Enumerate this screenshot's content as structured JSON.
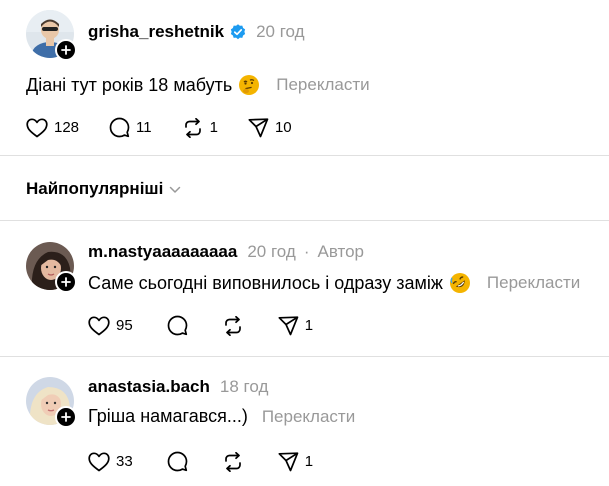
{
  "post": {
    "username": "grisha_reshetnik",
    "verified_icon": "verified-badge-icon",
    "time": "20 год",
    "text": "Діані тут років 18 мабуть",
    "emoji": "thinking-face-emoji",
    "translate": "Перекласти",
    "likes": "128",
    "replies": "11",
    "reposts": "1",
    "shares": "10"
  },
  "sort": {
    "label": "Найпопулярніші"
  },
  "comments": [
    {
      "username": "m.nastyaaaaaaaaa",
      "time": "20 год",
      "separator": "·",
      "author_label": "Автор",
      "text": "Саме сьогодні виповнилось і одразу заміж",
      "emoji": "rolling-on-floor-laughing-emoji",
      "translate": "Перекласти",
      "likes": "95",
      "shares": "1"
    },
    {
      "username": "anastasia.bach",
      "time": "18 год",
      "text": "Гріша намагався...)",
      "translate": "Перекласти",
      "likes": "33",
      "shares": "1"
    }
  ],
  "colors": {
    "verified": "#1d9bf0",
    "muted": "#999999",
    "divider": "#e0e0e0",
    "emoji": "#f4b400"
  }
}
